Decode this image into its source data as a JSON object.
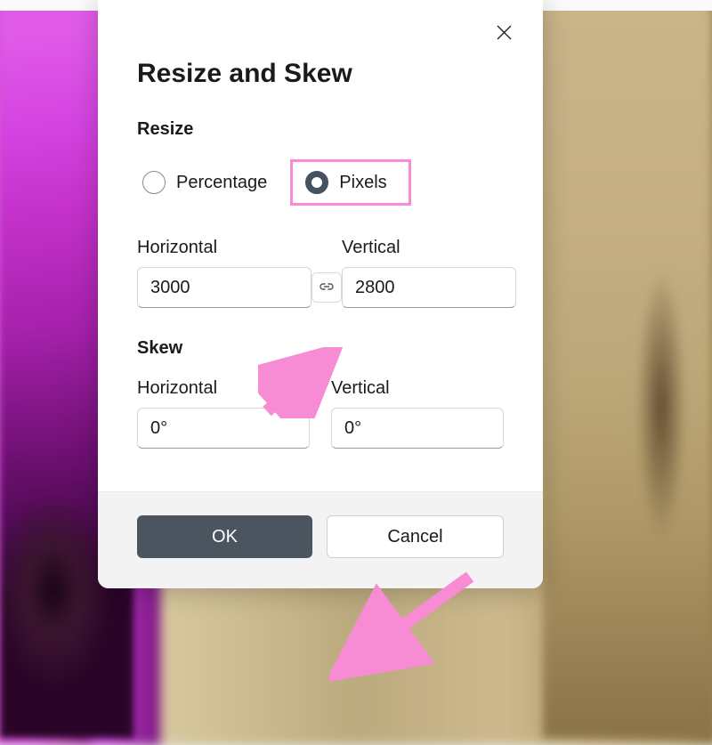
{
  "dialog": {
    "title": "Resize and Skew",
    "close_icon": "close-icon"
  },
  "resize": {
    "section_label": "Resize",
    "radio_percentage": "Percentage",
    "radio_pixels": "Pixels",
    "selected": "pixels",
    "horizontal_label": "Horizontal",
    "vertical_label": "Vertical",
    "horizontal_value": "3000",
    "vertical_value": "2800",
    "link_icon": "link-icon"
  },
  "skew": {
    "section_label": "Skew",
    "horizontal_label": "Horizontal",
    "vertical_label": "Vertical",
    "horizontal_value": "0°",
    "vertical_value": "0°"
  },
  "footer": {
    "ok_label": "OK",
    "cancel_label": "Cancel"
  },
  "annotations": {
    "highlight": "pixels-radio",
    "arrows": [
      "to-link-button",
      "to-ok-button"
    ],
    "color": "#f78bd4"
  }
}
